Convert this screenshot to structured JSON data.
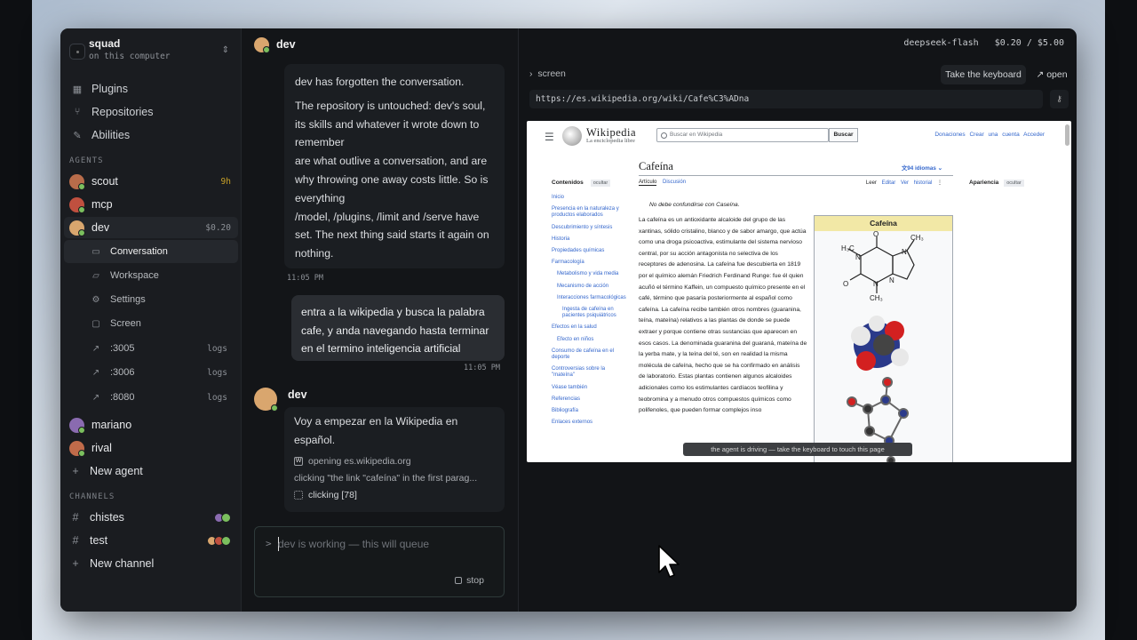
{
  "workspace": {
    "name": "squad",
    "subtitle": "on this computer"
  },
  "sidebar_nav": [
    {
      "label": "Plugins",
      "icon": "grid-icon"
    },
    {
      "label": "Repositories",
      "icon": "branch-icon"
    },
    {
      "label": "Abilities",
      "icon": "wrench-icon"
    }
  ],
  "sections": {
    "agents": "AGENTS",
    "channels": "CHANNELS"
  },
  "agents": {
    "scout": {
      "name": "scout",
      "meta": "9h",
      "color": "#b86c4a"
    },
    "mcp": {
      "name": "mcp",
      "color": "#c0503f"
    },
    "dev": {
      "name": "dev",
      "meta": "$0.20",
      "color": "#d9a66e"
    },
    "mariano": {
      "name": "mariano",
      "color": "#8a6bb0"
    },
    "rival": {
      "name": "rival",
      "color": "#c06b4a"
    }
  },
  "dev_items": [
    {
      "label": "Conversation",
      "icon": "chat-icon"
    },
    {
      "label": "Workspace",
      "icon": "folder-icon"
    },
    {
      "label": "Settings",
      "icon": "gear-icon"
    },
    {
      "label": "Screen",
      "icon": "monitor-icon"
    },
    {
      "label": ":3005",
      "meta": "logs",
      "icon": "external-link-icon"
    },
    {
      "label": ":3006",
      "meta": "logs",
      "icon": "external-link-icon"
    },
    {
      "label": ":8080",
      "meta": "logs",
      "icon": "external-link-icon"
    }
  ],
  "new_agent": "New agent",
  "channels": [
    {
      "name": "chistes"
    },
    {
      "name": "test"
    }
  ],
  "new_channel": "New channel",
  "chat": {
    "title": "dev",
    "msg1": {
      "p1": "dev has forgotten the conversation.",
      "p2": "The repository is untouched: dev's soul, its skills and whatever it wrote down to remember",
      "p3": "are what outlive a conversation, and are why throwing one away costs little. So is everything",
      "p4": "/model, /plugins, /limit and /serve have set. The next thing said starts it again on nothing.",
      "time": "11:05 PM"
    },
    "user_msg": {
      "text": "entra a la wikipedia y busca la palabra cafe, y anda navegando hasta terminar en el termino inteligencia artificial",
      "time": "11:05 PM"
    },
    "reply": {
      "author": "dev",
      "text": "Voy a empezar en la Wikipedia en español.",
      "tool1": "opening es.wikipedia.org",
      "tool2": "clicking \"the link \"cafeína\" in the first parag...",
      "tool3": "clicking [78]"
    },
    "input": {
      "prompt": ">",
      "placeholder": "dev is working — this will queue",
      "stop": "stop"
    }
  },
  "topbar": {
    "model": "deepseek-flash",
    "cost": "$0.20 / $5.00"
  },
  "screen": {
    "title": "screen",
    "take_keyboard": "Take the keyboard",
    "open": "open",
    "url": "https://es.wikipedia.org/wiki/Cafe%C3%ADna",
    "toast": "the agent is driving — take the keyboard to touch this page"
  },
  "wiki": {
    "brand": "Wikipedia",
    "tagline": "La enciclopedia libre",
    "search_placeholder": "Buscar en Wikipedia",
    "search_button": "Buscar",
    "top_links": "Donaciones Crear una cuenta Acceder",
    "toc_title": "Contenidos",
    "hide": "ocultar",
    "toc": [
      {
        "t": "Inicio",
        "lvl": 0
      },
      {
        "t": "Presencia en la naturaleza y productos elaborados",
        "lvl": 0
      },
      {
        "t": "Descubrimiento y síntesis",
        "lvl": 0
      },
      {
        "t": "Historia",
        "lvl": 0
      },
      {
        "t": "Propiedades químicas",
        "lvl": 0
      },
      {
        "t": "Farmacología",
        "lvl": 0
      },
      {
        "t": "Metabolismo y vida media",
        "lvl": 1
      },
      {
        "t": "Mecanismo de acción",
        "lvl": 1
      },
      {
        "t": "Interacciones farmacológicas",
        "lvl": 1
      },
      {
        "t": "Ingesta de cafeína en pacientes psiquiátricos",
        "lvl": 2
      },
      {
        "t": "Efectos en la salud",
        "lvl": 0
      },
      {
        "t": "Efecto en niños",
        "lvl": 1
      },
      {
        "t": "Consumo de cafeína en el deporte",
        "lvl": 0
      },
      {
        "t": "Controversias sobre la \"mateína\"",
        "lvl": 0
      },
      {
        "t": "Véase también",
        "lvl": 0
      },
      {
        "t": "Referencias",
        "lvl": 0
      },
      {
        "t": "Bibliografía",
        "lvl": 0
      },
      {
        "t": "Enlaces externos",
        "lvl": 0
      }
    ],
    "title": "Cafeína",
    "langs": "94 idiomas",
    "tab_article": "Artículo",
    "tab_talk": "Discusión",
    "tab_read": "Leer",
    "tab_edit": "Editar",
    "tab_history": "Ver historial",
    "hatnote": "No debe confundirse con Caseína.",
    "infobox_title": "Cafeína",
    "appearance": "Apariencia",
    "body": "La cafeína es un antioxidante alcaloide del grupo de las xantinas, sólido cristalino, blanco y de sabor amargo, que actúa como una droga psicoactiva, estimulante del sistema nervioso central, por su acción antagonista no selectiva de los receptores de adenosina. La cafeína fue descubierta en 1819 por el químico alemán Friedrich Ferdinand Runge: fue él quien acuñó el término Kaffein, un compuesto químico presente en el café, término que pasaría posteriormente al español como cafeína. La cafeína recibe también otros nombres (guaranina, teína, mateína) relativos a las plantas de donde se puede extraer y porque contiene otras sustancias que aparecen en esos casos. La denominada guaranina del guaraná, mateína de la yerba mate, y la teína del té, son en realidad la misma molécula de cafeína, hecho que se ha confirmado en análisis de laboratorio. Estas plantas contienen algunos alcaloides adicionales como los estimulantes cardíacos teofilina y teobromina y a menudo otros compuestos químicos como polifenoles, que pueden formar complejos inso"
  }
}
